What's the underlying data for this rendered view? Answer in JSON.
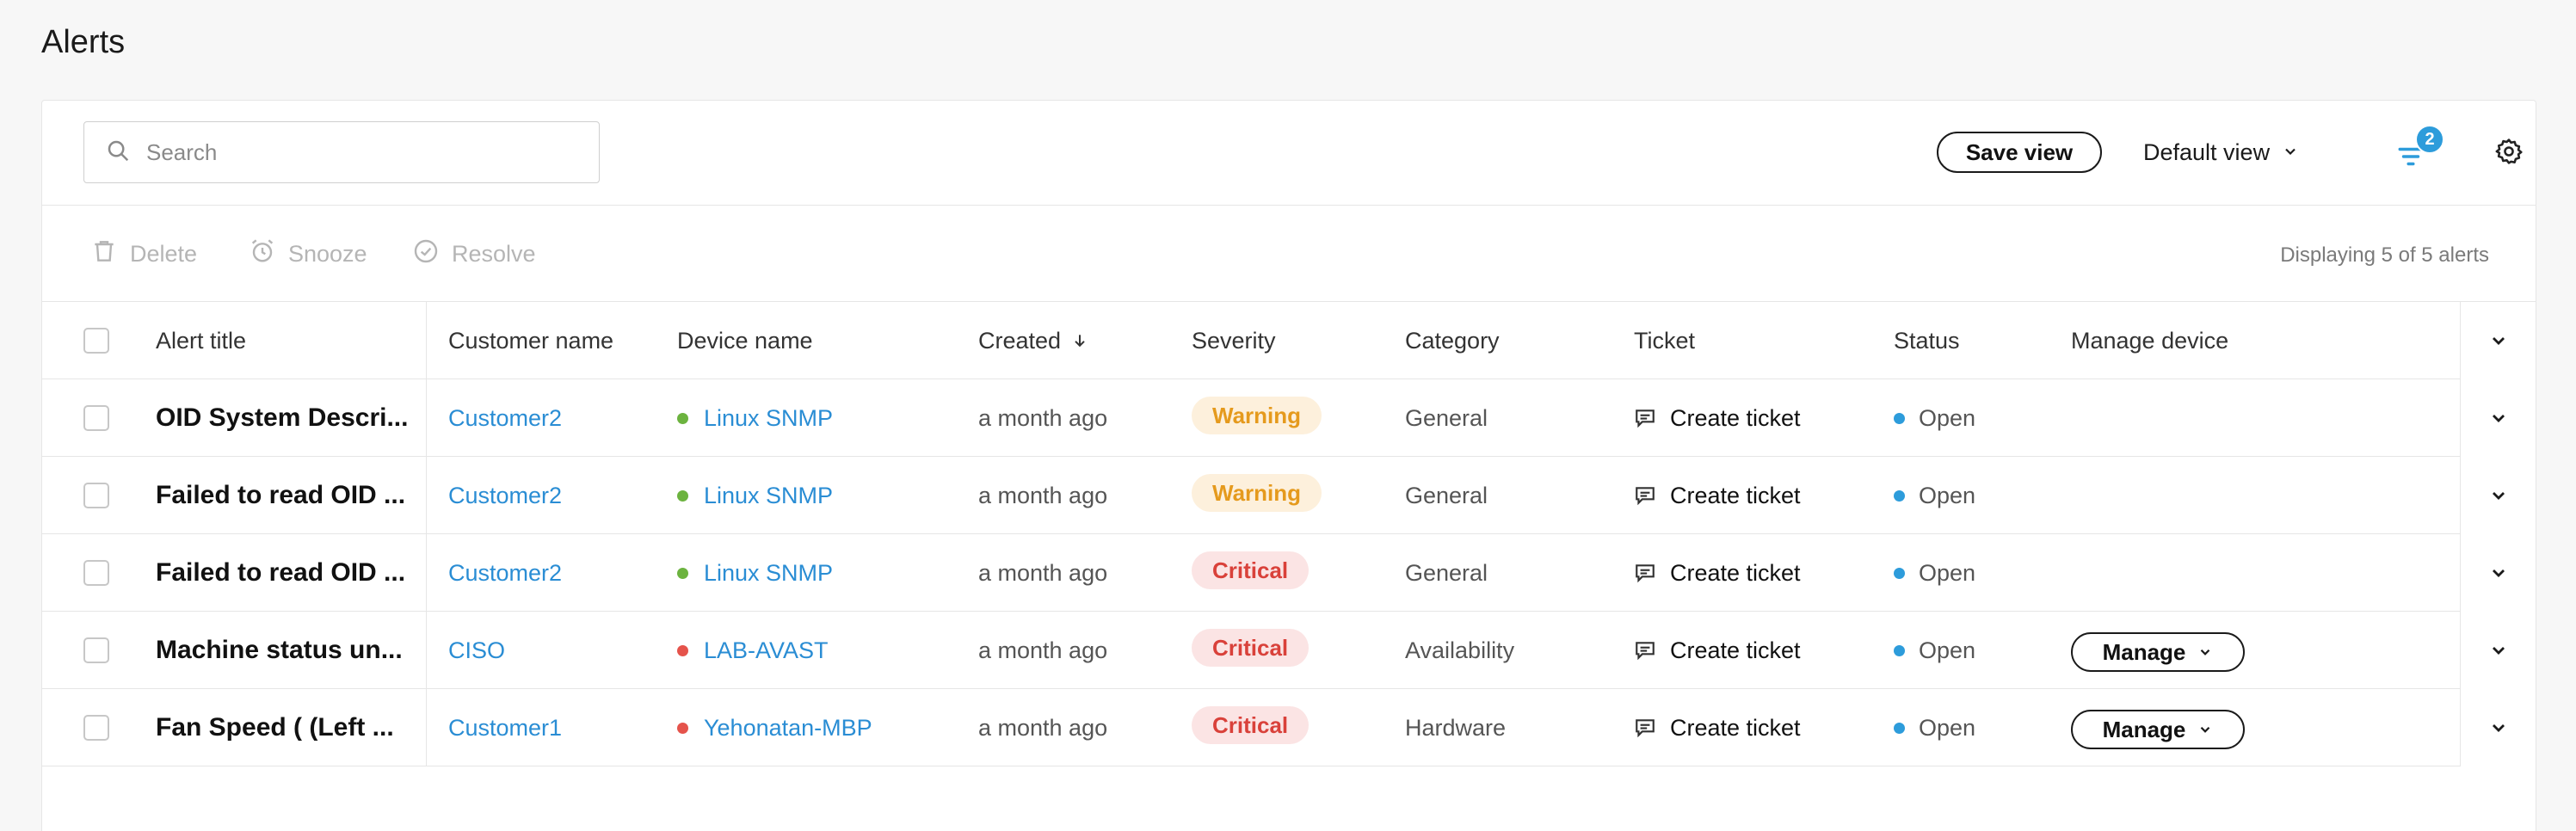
{
  "page": {
    "title": "Alerts"
  },
  "toolbar": {
    "search_placeholder": "Search",
    "save_view_label": "Save view",
    "default_view_label": "Default view",
    "filter_count": "2"
  },
  "actions": {
    "delete_label": "Delete",
    "snooze_label": "Snooze",
    "resolve_label": "Resolve",
    "displaying_text": "Displaying 5 of 5 alerts"
  },
  "table": {
    "columns": {
      "alert_title": "Alert title",
      "customer_name": "Customer name",
      "device_name": "Device name",
      "created": "Created",
      "severity": "Severity",
      "category": "Category",
      "ticket": "Ticket",
      "status": "Status",
      "manage_device": "Manage device"
    },
    "rows": [
      {
        "title": "OID System Descri...",
        "customer": "Customer2",
        "device": "Linux SNMP",
        "device_status_color": "#6cb33f",
        "created": "a month ago",
        "severity": "Warning",
        "category": "General",
        "ticket": "Create ticket",
        "status": "Open",
        "manage": ""
      },
      {
        "title": "Failed to read OID ...",
        "customer": "Customer2",
        "device": "Linux SNMP",
        "device_status_color": "#6cb33f",
        "created": "a month ago",
        "severity": "Warning",
        "category": "General",
        "ticket": "Create ticket",
        "status": "Open",
        "manage": ""
      },
      {
        "title": "Failed to read OID ...",
        "customer": "Customer2",
        "device": "Linux SNMP",
        "device_status_color": "#6cb33f",
        "created": "a month ago",
        "severity": "Critical",
        "category": "General",
        "ticket": "Create ticket",
        "status": "Open",
        "manage": ""
      },
      {
        "title": "Machine status un...",
        "customer": "CISO",
        "device": "LAB-AVAST",
        "device_status_color": "#e5534b",
        "created": "a month ago",
        "severity": "Critical",
        "category": "Availability",
        "ticket": "Create ticket",
        "status": "Open",
        "manage": "Manage"
      },
      {
        "title": "Fan Speed ( (Left ...",
        "customer": "Customer1",
        "device": "Yehonatan-MBP",
        "device_status_color": "#e5534b",
        "created": "a month ago",
        "severity": "Critical",
        "category": "Hardware",
        "ticket": "Create ticket",
        "status": "Open",
        "manage": "Manage"
      }
    ]
  },
  "colors": {
    "accent": "#2d9cdb",
    "link": "#2a8dd4",
    "warning_bg": "#fdf0dc",
    "warning_text": "#e59a1d",
    "critical_bg": "#fbe4e4",
    "critical_text": "#d9413a",
    "open_dot": "#2d9cdb"
  }
}
